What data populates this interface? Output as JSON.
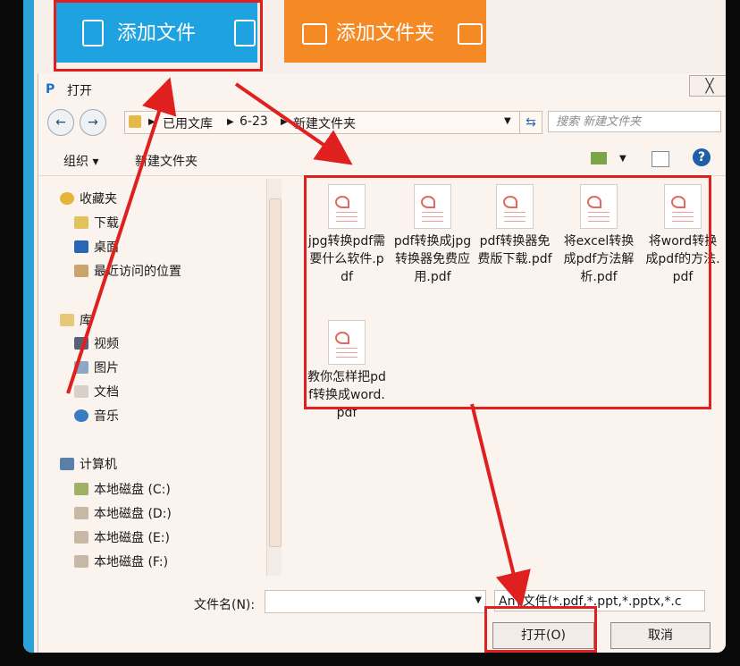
{
  "app": {
    "add_file_label": "添加文件",
    "add_folder_label": "添加文件夹"
  },
  "dialog": {
    "title": "打开",
    "close_glyph": "╳",
    "breadcrumb": [
      "已用文库",
      "6-23",
      "新建文件夹"
    ],
    "search_placeholder": "搜索 新建文件夹",
    "toolbar": {
      "organize": "组织 ▾",
      "new_folder": "新建文件夹"
    },
    "sidebar": {
      "favorites": {
        "label": "收藏夹",
        "items": [
          "下载",
          "桌面",
          "最近访问的位置"
        ]
      },
      "libraries": {
        "label": "库",
        "items": [
          "视频",
          "图片",
          "文档",
          "音乐"
        ]
      },
      "computer": {
        "label": "计算机",
        "items": [
          "本地磁盘 (C:)",
          "本地磁盘 (D:)",
          "本地磁盘 (E:)",
          "本地磁盘 (F:)"
        ]
      }
    },
    "files": [
      "jpg转换pdf需要什么软件.pdf",
      "pdf转换成jpg转换器免费应用.pdf",
      "pdf转换器免费版下载.pdf",
      "将excel转换成pdf方法解析.pdf",
      "将word转换成pdf的方法.pdf",
      "教你怎样把pdf转换成word.pdf"
    ],
    "filename_label": "文件名(N):",
    "filename_value": "",
    "file_type_filter": "Any文件(*.pdf,*.ppt,*.pptx,*.c",
    "open_button": "打开(O)",
    "cancel_button": "取消"
  },
  "colors": {
    "blue_button": "#1ea2e0",
    "orange_button": "#f58a25",
    "annotation_red": "#e01f1f"
  }
}
